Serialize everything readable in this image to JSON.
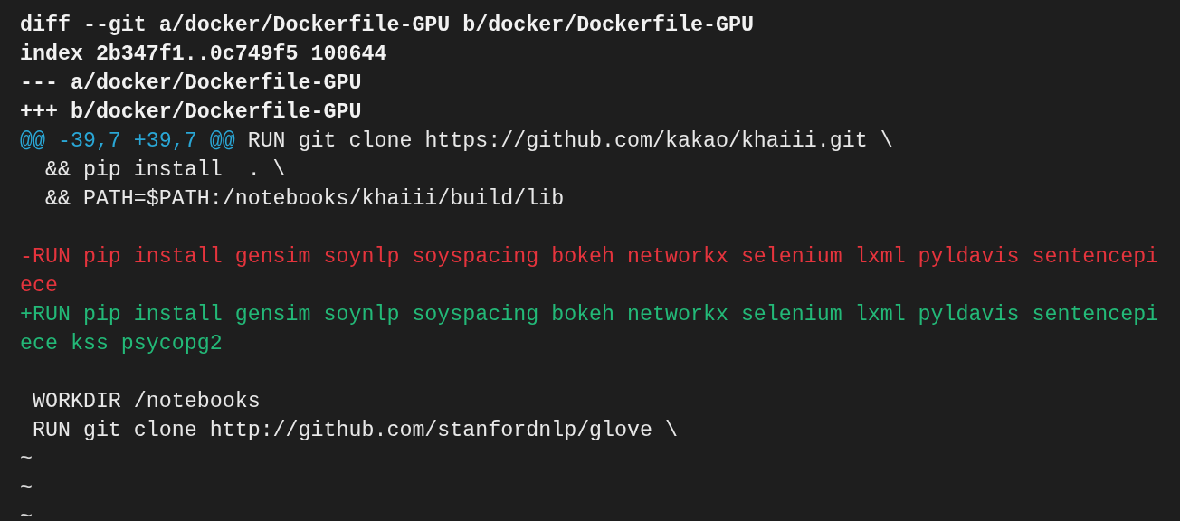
{
  "terminal": {
    "lines": [
      {
        "kind": "header",
        "text": "diff --git a/docker/Dockerfile-GPU b/docker/Dockerfile-GPU"
      },
      {
        "kind": "header",
        "text": "index 2b347f1..0c749f5 100644"
      },
      {
        "kind": "header",
        "text": "--- a/docker/Dockerfile-GPU"
      },
      {
        "kind": "header",
        "text": "+++ b/docker/Dockerfile-GPU"
      },
      {
        "kind": "hunk",
        "range": "@@ -39,7 +39,7 @@",
        "text": " RUN git clone https://github.com/kakao/khaiii.git \\"
      },
      {
        "kind": "context",
        "text": "  && pip install  . \\"
      },
      {
        "kind": "context",
        "text": "  && PATH=$PATH:/notebooks/khaiii/build/lib"
      },
      {
        "kind": "blank"
      },
      {
        "kind": "removed",
        "text": "-RUN pip install gensim soynlp soyspacing bokeh networkx selenium lxml pyldavis sentencepi"
      },
      {
        "kind": "removed",
        "text": "ece"
      },
      {
        "kind": "added",
        "text": "+RUN pip install gensim soynlp soyspacing bokeh networkx selenium lxml pyldavis sentencepi"
      },
      {
        "kind": "added",
        "text": "ece kss psycopg2"
      },
      {
        "kind": "blank"
      },
      {
        "kind": "context",
        "text": " WORKDIR /notebooks"
      },
      {
        "kind": "context",
        "text": " RUN git clone http://github.com/stanfordnlp/glove \\"
      },
      {
        "kind": "tilde",
        "text": "~"
      },
      {
        "kind": "tilde",
        "text": "~"
      },
      {
        "kind": "tilde",
        "text": "~"
      }
    ]
  }
}
